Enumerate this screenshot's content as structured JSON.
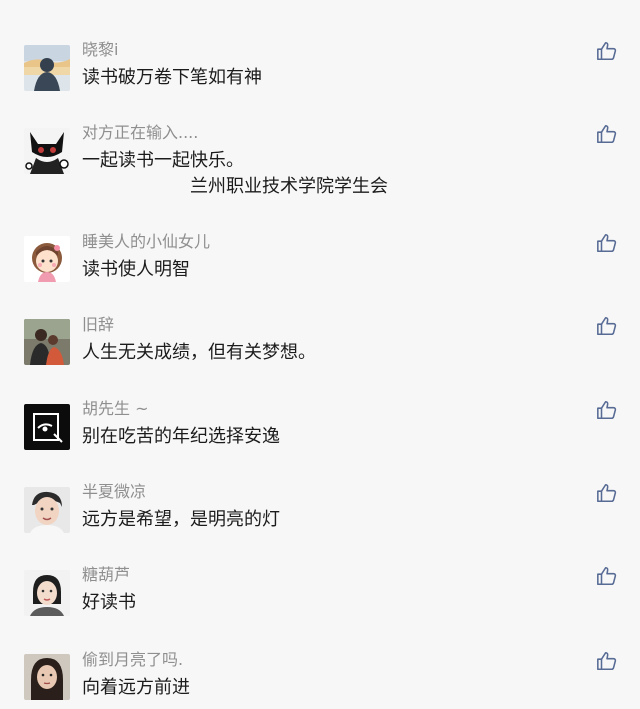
{
  "comments": [
    {
      "nickname": "晓黎i",
      "text": "读书破万卷下笔如有神",
      "avatar": "avatar-landscape-silhouette"
    },
    {
      "nickname": "对方正在输入....",
      "text": "一起读书一起快乐。",
      "text_line2": "兰州职业技术学院学生会",
      "avatar": "avatar-black-cat-girl"
    },
    {
      "nickname": "睡美人的小仙女儿",
      "text": "读书使人明智",
      "avatar": "avatar-cartoon-girl"
    },
    {
      "nickname": "旧辞",
      "text": "人生无关成绩，但有关梦想。",
      "avatar": "avatar-couple-photo"
    },
    {
      "nickname": "胡先生 ~",
      "text": "别在吃苦的年纪选择安逸",
      "avatar": "avatar-black-sketch"
    },
    {
      "nickname": "半夏微凉",
      "text": "远方是希望，是明亮的灯",
      "avatar": "avatar-young-man"
    },
    {
      "nickname": "糖葫芦",
      "text": "好读书",
      "avatar": "avatar-woman-portrait"
    },
    {
      "nickname": "偷到月亮了吗.",
      "text": "向着远方前进",
      "avatar": "avatar-girl-portrait"
    }
  ],
  "like_icon": "thumbs-up-icon",
  "colors": {
    "background": "#f7f7f7",
    "nickname": "#8f8f8f",
    "text": "#1c1c1c",
    "like_icon": "#576b95"
  }
}
